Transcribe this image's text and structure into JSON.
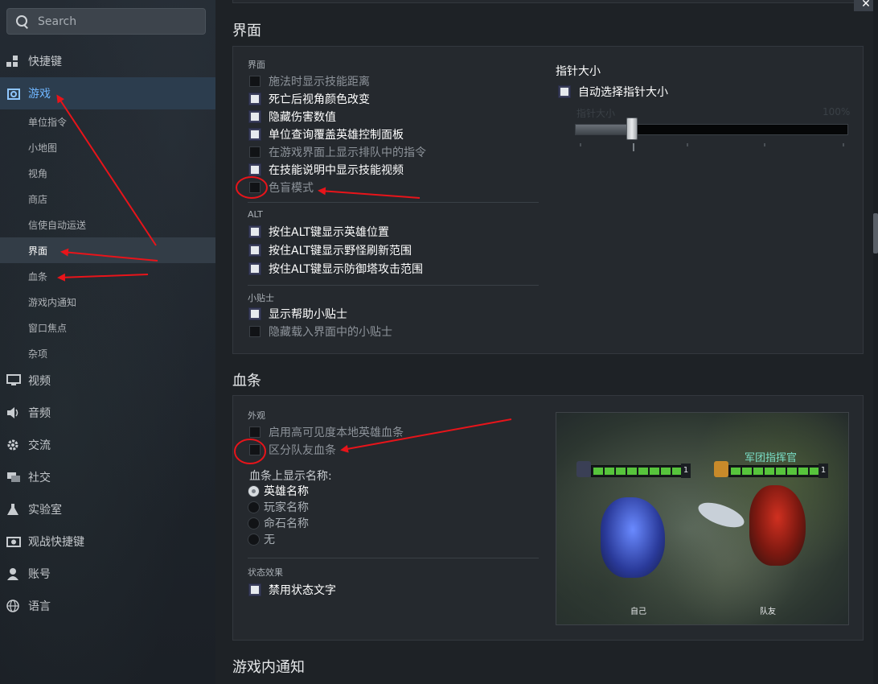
{
  "search": {
    "placeholder": "Search"
  },
  "sidebar": {
    "items": [
      {
        "label": "快捷键",
        "icon": "grid-icon"
      },
      {
        "label": "游戏",
        "icon": "gamepad-icon",
        "active": true
      },
      {
        "label": "单位指令",
        "sub": true
      },
      {
        "label": "小地图",
        "sub": true
      },
      {
        "label": "视角",
        "sub": true
      },
      {
        "label": "商店",
        "sub": true
      },
      {
        "label": "信使自动运送",
        "sub": true
      },
      {
        "label": "界面",
        "sub": true,
        "active": true
      },
      {
        "label": "血条",
        "sub": true
      },
      {
        "label": "游戏内通知",
        "sub": true
      },
      {
        "label": "窗口焦点",
        "sub": true
      },
      {
        "label": "杂项",
        "sub": true
      },
      {
        "label": "视频",
        "icon": "monitor-icon"
      },
      {
        "label": "音频",
        "icon": "speaker-icon"
      },
      {
        "label": "交流",
        "icon": "gear-icon"
      },
      {
        "label": "社交",
        "icon": "chat-icon"
      },
      {
        "label": "实验室",
        "icon": "flask-icon"
      },
      {
        "label": "观战快捷键",
        "icon": "camera-icon"
      },
      {
        "label": "账号",
        "icon": "user-icon"
      },
      {
        "label": "语言",
        "icon": "globe-icon"
      }
    ]
  },
  "interface": {
    "title": "界面",
    "group_main": "界面",
    "options": [
      {
        "label": "施法时显示技能距离",
        "checked": false
      },
      {
        "label": "死亡后视角颜色改变",
        "checked": true
      },
      {
        "label": "隐藏伤害数值",
        "checked": true
      },
      {
        "label": "单位查询覆盖英雄控制面板",
        "checked": true
      },
      {
        "label": "在游戏界面上显示排队中的指令",
        "checked": false
      },
      {
        "label": "在技能说明中显示技能视频",
        "checked": true
      },
      {
        "label": "色盲模式",
        "checked": false
      }
    ],
    "group_alt": "ALT",
    "alt_options": [
      {
        "label": "按住ALT键显示英雄位置",
        "checked": true
      },
      {
        "label": "按住ALT键显示野怪刷新范围",
        "checked": true
      },
      {
        "label": "按住ALT键显示防御塔攻击范围",
        "checked": true
      }
    ],
    "group_tips": "小贴士",
    "tips_options": [
      {
        "label": "显示帮助小贴士",
        "checked": true
      },
      {
        "label": "隐藏载入界面中的小贴士",
        "checked": false
      }
    ],
    "cursor": {
      "heading": "指针大小",
      "auto_label": "自动选择指针大小",
      "auto_checked": true,
      "slider_label": "指针大小",
      "slider_value": "100%",
      "slider_fraction": 0.21
    }
  },
  "healthbar": {
    "title": "血条",
    "group_appearance": "外观",
    "options": [
      {
        "label": "启用高可见度本地英雄血条",
        "checked": false
      },
      {
        "label": "区分队友血条",
        "checked": false
      }
    ],
    "name_label": "血条上显示名称:",
    "name_options": [
      {
        "label": "英雄名称",
        "selected": true
      },
      {
        "label": "玩家名称",
        "selected": false
      },
      {
        "label": "命石名称",
        "selected": false
      },
      {
        "label": "无",
        "selected": false
      }
    ],
    "group_status": "状态效果",
    "status_options": [
      {
        "label": "禁用状态文字",
        "checked": true
      }
    ],
    "preview": {
      "ally_name": "军团指挥官",
      "self_level": "1",
      "ally_level": "1",
      "caption_self": "自己",
      "caption_ally": "队友"
    }
  },
  "next_section": {
    "title": "游戏内通知"
  },
  "close_icon": "close-icon",
  "colors": {
    "annotation": "#e8141a",
    "active_nav": "#2c3d4e",
    "hp_green": "#57c43c"
  }
}
